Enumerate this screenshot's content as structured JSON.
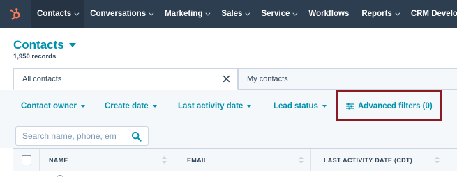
{
  "nav": {
    "items": [
      {
        "label": "Contacts",
        "has_caret": true
      },
      {
        "label": "Conversations",
        "has_caret": true
      },
      {
        "label": "Marketing",
        "has_caret": true
      },
      {
        "label": "Sales",
        "has_caret": true
      },
      {
        "label": "Service",
        "has_caret": true
      },
      {
        "label": "Workflows",
        "has_caret": false
      },
      {
        "label": "Reports",
        "has_caret": true
      },
      {
        "label": "CRM Developme",
        "has_caret": false
      }
    ],
    "active_index": 0,
    "logo_icon": "hubspot-sprocket-icon",
    "colors": {
      "background": "#2d3e50",
      "logo": "#ff7a59"
    }
  },
  "page": {
    "title": "Contacts",
    "record_count": "1,950 records"
  },
  "view_tabs": {
    "all": "All contacts",
    "my": "My contacts",
    "close_icon": "close-icon"
  },
  "filters": {
    "contact_owner": "Contact owner",
    "create_date": "Create date",
    "last_activity_date": "Last activity date",
    "lead_status": "Lead status",
    "advanced": "Advanced filters (0)",
    "advanced_icon": "sliders-icon",
    "highlight_color": "#8b1a22"
  },
  "search": {
    "placeholder": "Search name, phone, em",
    "icon": "search-icon"
  },
  "table": {
    "columns": [
      "NAME",
      "EMAIL",
      "LAST ACTIVITY DATE (CDT)"
    ]
  },
  "accent_color": "#0091ae"
}
